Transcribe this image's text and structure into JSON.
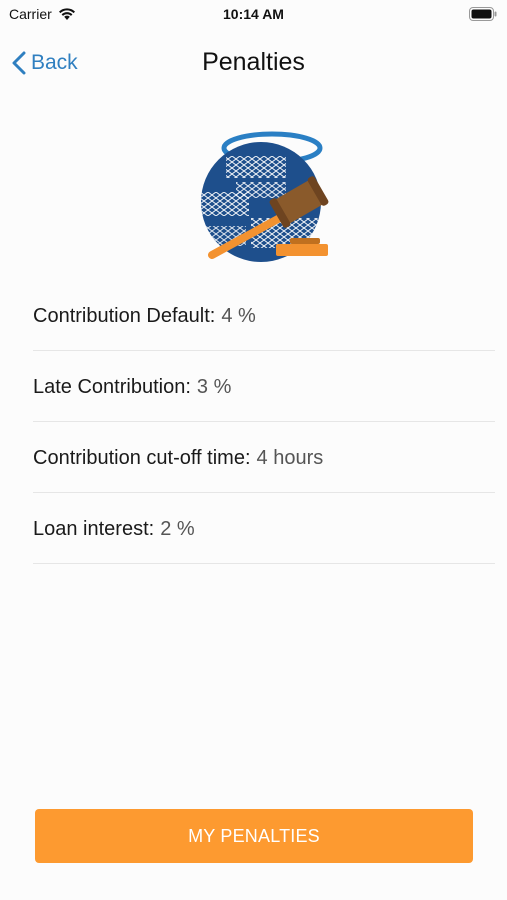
{
  "status_bar": {
    "carrier": "Carrier",
    "time": "10:14 AM"
  },
  "nav": {
    "back_label": "Back",
    "title": "Penalties"
  },
  "penalties": [
    {
      "label": "Contribution Default:",
      "value": "4 %"
    },
    {
      "label": "Late Contribution:",
      "value": "3 %"
    },
    {
      "label": "Contribution cut-off time:",
      "value": "4 hours"
    },
    {
      "label": "Loan interest:",
      "value": "2 %"
    }
  ],
  "action": {
    "button_label": "MY PENALTIES"
  },
  "colors": {
    "accent": "#2f7fc0",
    "button": "#fd9a30",
    "globe": "#1e4f8c",
    "gavel_handle": "#f39230",
    "gavel_head": "#8a5a2b"
  },
  "icons": {
    "logo": "globe-with-gavel-icon",
    "back": "chevron-left-icon",
    "wifi": "wifi-icon",
    "battery": "battery-icon"
  }
}
